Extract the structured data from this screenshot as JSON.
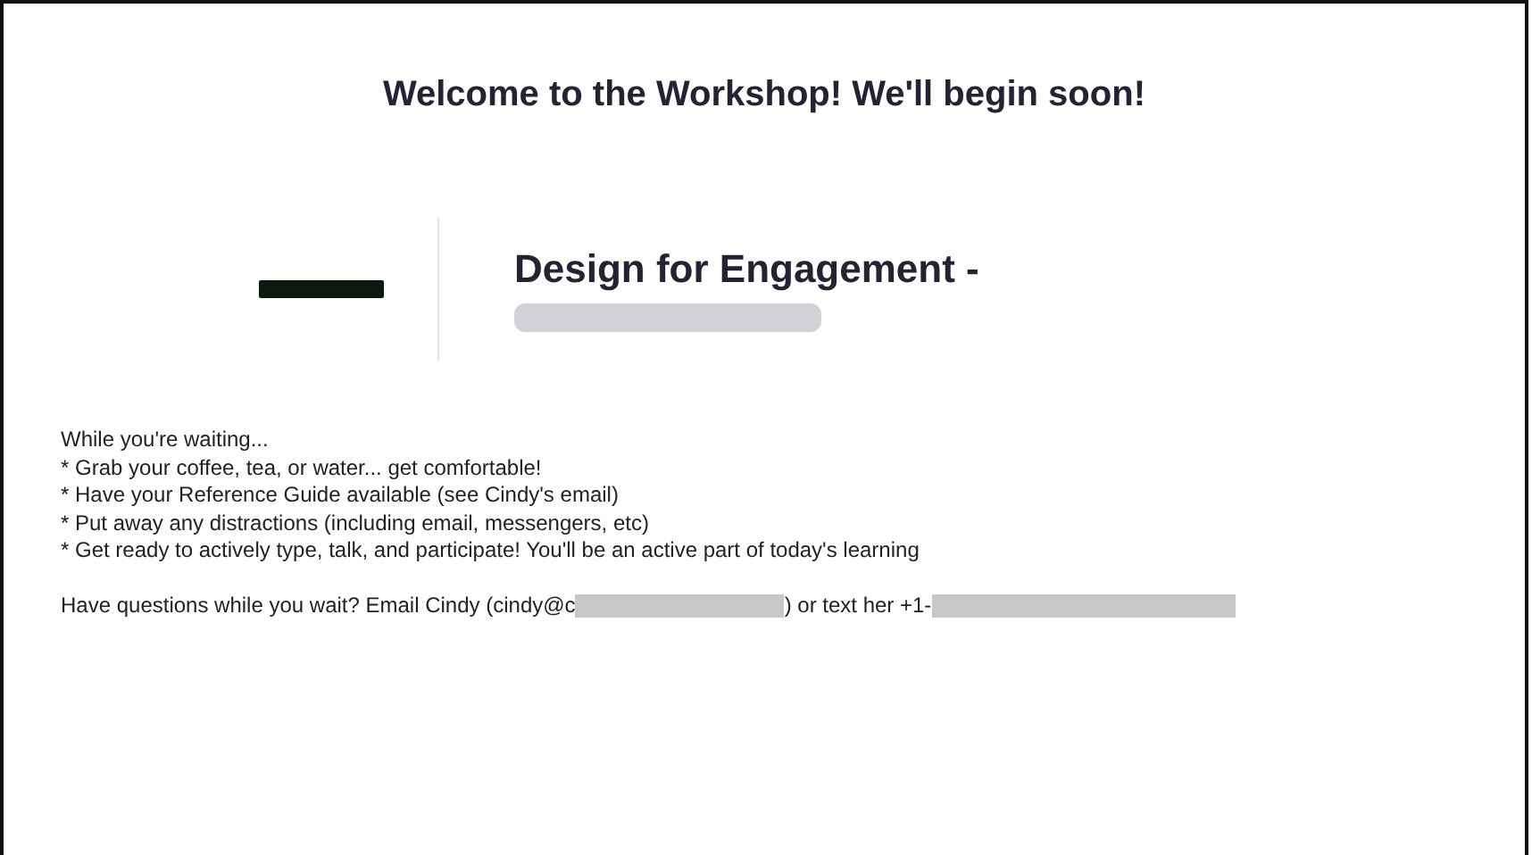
{
  "title": "Welcome to the Workshop! We'll begin soon!",
  "event": {
    "heading": "Design for Engagement -"
  },
  "intro": "While you're waiting...",
  "bullets": [
    "* Grab your coffee, tea, or water... get comfortable!",
    "* Have your Reference Guide available (see Cindy's email)",
    "* Put away any distractions (including email, messengers, etc)",
    "* Get ready to actively type, talk, and participate! You'll be an active part of today's learning"
  ],
  "contact": {
    "before": "Have questions while you wait? Email Cindy (cindy@c",
    "middle": ") or text her +1-"
  }
}
